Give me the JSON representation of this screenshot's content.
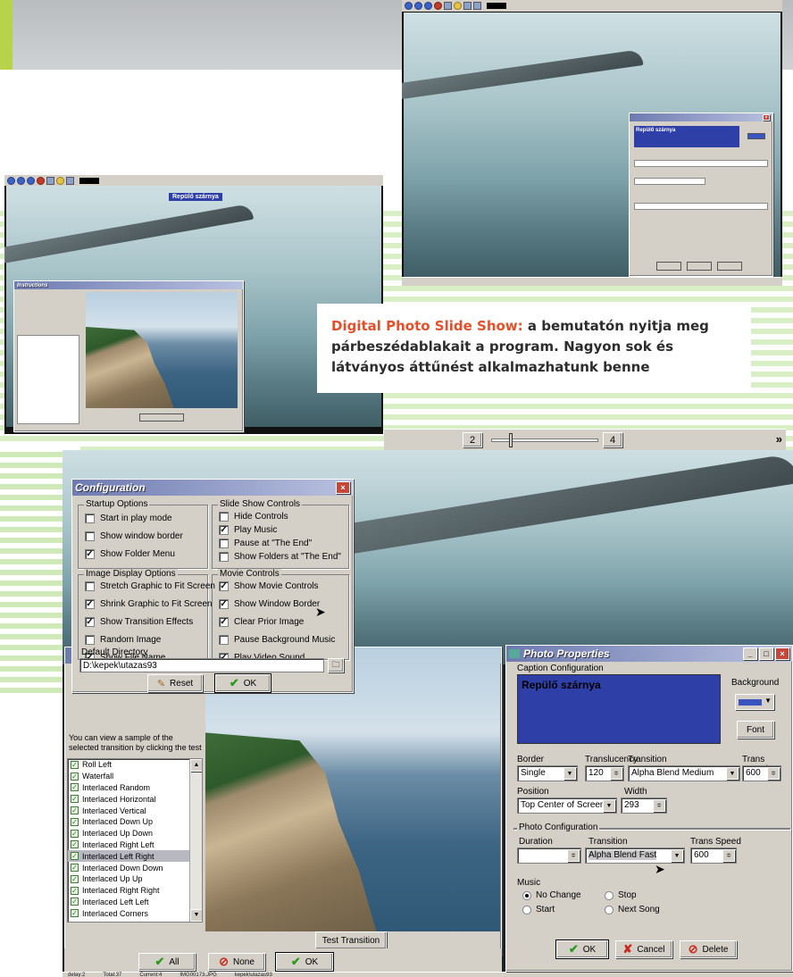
{
  "caption": {
    "highlight": "Digital Photo Slide Show:",
    "body": " a bemutatón nyitja meg párbeszédablakait a program. Nagyon sok és látványos áttűnést alkalmazhatunk benne"
  },
  "playback": {
    "prev_num": "2",
    "next_num": "4",
    "arrow": "»",
    "progress": 0.6
  },
  "thumb_left": {
    "caption_banner": "Repülő szárnya",
    "small_title": "Instructions"
  },
  "config": {
    "title": "Configuration",
    "startup": {
      "title": "Startup Options",
      "items": [
        {
          "label": "Start in play mode",
          "checked": false
        },
        {
          "label": "Show window border",
          "checked": false
        },
        {
          "label": "Show Folder Menu",
          "checked": true
        }
      ]
    },
    "slideshow": {
      "title": "Slide Show Controls",
      "items": [
        {
          "label": "Hide Controls",
          "checked": false
        },
        {
          "label": "Play Music",
          "checked": true
        },
        {
          "label": "Pause at \"The End\"",
          "checked": false
        },
        {
          "label": "Show Folders at \"The End\"",
          "checked": false
        }
      ]
    },
    "image_display": {
      "title": "Image Display Options",
      "items": [
        {
          "label": "Stretch Graphic to Fit Screen",
          "checked": false
        },
        {
          "label": "Shrink Graphic to Fit Screen",
          "checked": true
        },
        {
          "label": "Show Transition Effects",
          "checked": true
        },
        {
          "label": "Random Image",
          "checked": false
        },
        {
          "label": "Show File Name",
          "checked": true
        }
      ]
    },
    "movie": {
      "title": "Movie Controls",
      "items": [
        {
          "label": "Show Movie Controls",
          "checked": true
        },
        {
          "label": "Show Window Border",
          "checked": true
        },
        {
          "label": "Clear Prior Image",
          "checked": true
        },
        {
          "label": "Pause Background Music",
          "checked": false
        },
        {
          "label": "Play Video Sound",
          "checked": true
        }
      ]
    },
    "default_dir_label": "Default Directory",
    "default_dir_value": "D:\\kepek\\utazas93",
    "reset_label": "Reset",
    "ok_label": "OK"
  },
  "transitions": {
    "intro": "You can view a sample of the selected transition by clicking the test",
    "items": [
      {
        "label": "Roll Left",
        "selected": false
      },
      {
        "label": "Waterfall",
        "selected": false
      },
      {
        "label": "Interlaced Random",
        "selected": false
      },
      {
        "label": "Interlaced Horizontal",
        "selected": false
      },
      {
        "label": "Interlaced Vertical",
        "selected": false
      },
      {
        "label": "Interlaced Down Up",
        "selected": false
      },
      {
        "label": "Interlaced Up Down",
        "selected": false
      },
      {
        "label": "Interlaced Right Left",
        "selected": false
      },
      {
        "label": "Interlaced Left Right",
        "selected": true
      },
      {
        "label": "Interlaced Down Down",
        "selected": false
      },
      {
        "label": "Interlaced Up Up",
        "selected": false
      },
      {
        "label": "Interlaced Right Right",
        "selected": false
      },
      {
        "label": "Interlaced Left Left",
        "selected": false
      },
      {
        "label": "Interlaced Corners",
        "selected": false
      }
    ],
    "test_button": "Test Transition",
    "all_button": "All",
    "none_button": "None",
    "ok_button": "OK"
  },
  "photo_props": {
    "title": "Photo Properties",
    "caption_config": "Caption Configuration",
    "caption_text": "Repülő szárnya",
    "background_label": "Background",
    "font_button": "Font",
    "border_label": "Border",
    "border_value": "Single",
    "translucency_label": "Translucency",
    "translucency_value": "120",
    "transition_label": "Transition",
    "transition_value": "Alpha Blend Medium",
    "trans_speed_label": "Trans Speed",
    "trans_speed_value": "600",
    "position_label": "Position",
    "position_value": "Top Center of Screen",
    "width_label": "Width",
    "width_value": "293",
    "photo_config": "Photo Configuration",
    "duration_label": "Duration",
    "photo_transition_label": "Transition",
    "photo_transition_value": "Alpha Blend Fast",
    "photo_speed_label": "Trans Speed",
    "photo_speed_value": "600",
    "music_label": "Music",
    "music_options": [
      "No Change",
      "Stop",
      "Start",
      "Next Song"
    ],
    "ok_button": "OK",
    "cancel_button": "Cancel",
    "delete_button": "Delete"
  },
  "statusbar": [
    "delay:2",
    "Total:37",
    "Current:4",
    "IMG00173.JPG",
    "kepek\\utazas93"
  ],
  "colors": {
    "caption_blue": "#2f3fa8",
    "accent_orange": "#e4502a"
  }
}
